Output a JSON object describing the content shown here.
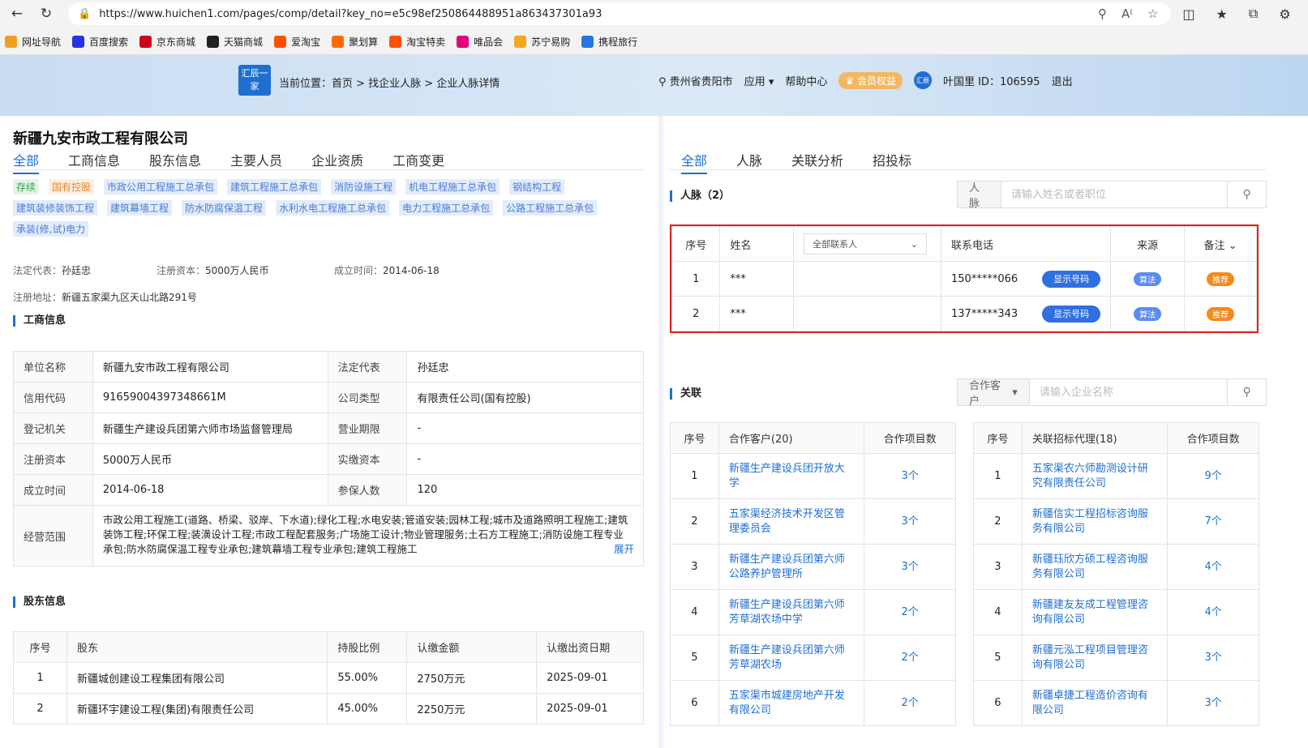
{
  "browser": {
    "url": "https://www.huichen1.com/pages/comp/detail?key_no=e5c98ef250864488951a863437301a93",
    "bookmarks": [
      {
        "label": "网址导航",
        "color": "#f0a020"
      },
      {
        "label": "百度搜索",
        "color": "#2932e1"
      },
      {
        "label": "京东商城",
        "color": "#d0021b"
      },
      {
        "label": "天猫商城",
        "color": "#222222"
      },
      {
        "label": "爱淘宝",
        "color": "#ff5000"
      },
      {
        "label": "聚划算",
        "color": "#ff6a00"
      },
      {
        "label": "淘宝特卖",
        "color": "#ff5000"
      },
      {
        "label": "唯品会",
        "color": "#e4007f"
      },
      {
        "label": "苏宁易购",
        "color": "#f5a623"
      },
      {
        "label": "携程旅行",
        "color": "#2577e3"
      }
    ]
  },
  "header": {
    "logo_text": "汇辰一家",
    "breadcrumb": "当前位置：首页 > 找企业人脉 > 企业人脉详情",
    "location": "贵州省贵阳市",
    "apps": "应用",
    "help": "帮助中心",
    "vip": "会员权益",
    "user": "叶国里 ID：106595",
    "logout": "退出"
  },
  "company": {
    "name": "新疆九安市政工程有限公司",
    "tabs": [
      "全部",
      "工商信息",
      "股东信息",
      "主要人员",
      "企业资质",
      "工商变更"
    ],
    "tags": [
      {
        "text": "存续",
        "kind": "green"
      },
      {
        "text": "国有控股",
        "kind": "orange"
      },
      {
        "text": "市政公用工程施工总承包",
        "kind": "blue"
      },
      {
        "text": "建筑工程施工总承包",
        "kind": "blue"
      },
      {
        "text": "消防设施工程",
        "kind": "blue"
      },
      {
        "text": "机电工程施工总承包",
        "kind": "blue"
      },
      {
        "text": "钢结构工程",
        "kind": "blue"
      },
      {
        "text": "建筑装修装饰工程",
        "kind": "blue"
      },
      {
        "text": "建筑幕墙工程",
        "kind": "blue"
      },
      {
        "text": "防水防腐保温工程",
        "kind": "blue"
      },
      {
        "text": "水利水电工程施工总承包",
        "kind": "blue"
      },
      {
        "text": "电力工程施工总承包",
        "kind": "blue"
      },
      {
        "text": "公路工程施工总承包",
        "kind": "blue"
      },
      {
        "text": "承装(修,试)电力",
        "kind": "blue"
      }
    ],
    "legal_rep_label": "法定代表：",
    "legal_rep": "孙廷忠",
    "reg_capital_label": "注册资本：",
    "reg_capital": "5000万人民币",
    "founded_label": "成立时间：",
    "founded": "2014-06-18",
    "address_label": "注册地址：",
    "address": "新疆五家渠九区天山北路291号"
  },
  "gongshang": {
    "title": "工商信息",
    "rows": [
      [
        "单位名称",
        "新疆九安市政工程有限公司",
        "法定代表",
        "孙廷忠"
      ],
      [
        "信用代码",
        "91659004397348661M",
        "公司类型",
        "有限责任公司(国有控股)"
      ],
      [
        "登记机关",
        "新疆生产建设兵团第六师市场监督管理局",
        "营业期限",
        "-"
      ],
      [
        "注册资本",
        "5000万人民币",
        "实缴资本",
        "-"
      ],
      [
        "成立时间",
        "2014-06-18",
        "参保人数",
        "120"
      ]
    ],
    "scope_label": "经营范围",
    "scope": "市政公用工程施工(道路、桥梁、驳岸、下水道);绿化工程;水电安装;管道安装;园林工程;城市及道路照明工程施工;建筑装饰工程;环保工程;装潢设计工程;市政工程配套服务;广场施工设计;物业管理服务;土石方工程施工;消防设施工程专业承包;防水防腐保温工程专业承包;建筑幕墙工程专业承包;建筑工程施工",
    "expand": "展开"
  },
  "shareholders": {
    "title": "股东信息",
    "headers": [
      "序号",
      "股东",
      "持股比例",
      "认缴金额",
      "认缴出资日期"
    ],
    "rows": [
      [
        "1",
        "新疆城创建设工程集团有限公司",
        "55.00%",
        "2750万元",
        "2025-09-01"
      ],
      [
        "2",
        "新疆环宇建设工程(集团)有限责任公司",
        "45.00%",
        "2250万元",
        "2025-09-01"
      ]
    ]
  },
  "right": {
    "tabs": [
      "全部",
      "人脉",
      "关联分析",
      "招投标"
    ],
    "contacts_title": "人脉（2）",
    "contacts_search_prefix": "人脉",
    "contacts_search_placeholder": "请输入姓名或者职位",
    "contacts_headers": {
      "no": "序号",
      "name": "姓名",
      "filter": "全部联系人",
      "phone": "联系电话",
      "source": "来源",
      "note": "备注"
    },
    "contacts": [
      {
        "no": "1",
        "name": "***",
        "phone": "150*****066",
        "show": "显示号码",
        "source": "算法",
        "note": "推荐"
      },
      {
        "no": "2",
        "name": "***",
        "phone": "137*****343",
        "show": "显示号码",
        "source": "算法",
        "note": "推荐"
      }
    ],
    "relation_title": "关联",
    "relation_search_prefix": "合作客户",
    "relation_search_placeholder": "请输入企业名称",
    "clients_headers": [
      "序号",
      "合作客户(20)",
      "合作项目数"
    ],
    "clients": [
      [
        "1",
        "新疆生产建设兵团开放大学",
        "3个"
      ],
      [
        "2",
        "五家渠经济技术开发区管理委员会",
        "3个"
      ],
      [
        "3",
        "新疆生产建设兵团第六师公路养护管理所",
        "3个"
      ],
      [
        "4",
        "新疆生产建设兵团第六师芳草湖农场中学",
        "2个"
      ],
      [
        "5",
        "新疆生产建设兵团第六师芳草湖农场",
        "2个"
      ],
      [
        "6",
        "五家渠市城建房地产开发有限公司",
        "2个"
      ]
    ],
    "agents_headers": [
      "序号",
      "关联招标代理(18)",
      "合作项目数"
    ],
    "agents": [
      [
        "1",
        "五家渠农六师勘测设计研究有限责任公司",
        "9个"
      ],
      [
        "2",
        "新疆信实工程招标咨询服务有限公司",
        "7个"
      ],
      [
        "3",
        "新疆珏欣方硕工程咨询服务有限公司",
        "4个"
      ],
      [
        "4",
        "新疆建友友成工程管理咨询有限公司",
        "4个"
      ],
      [
        "5",
        "新疆元泓工程项目管理咨询有限公司",
        "3个"
      ],
      [
        "6",
        "新疆卓捷工程造价咨询有限公司",
        "3个"
      ]
    ]
  }
}
